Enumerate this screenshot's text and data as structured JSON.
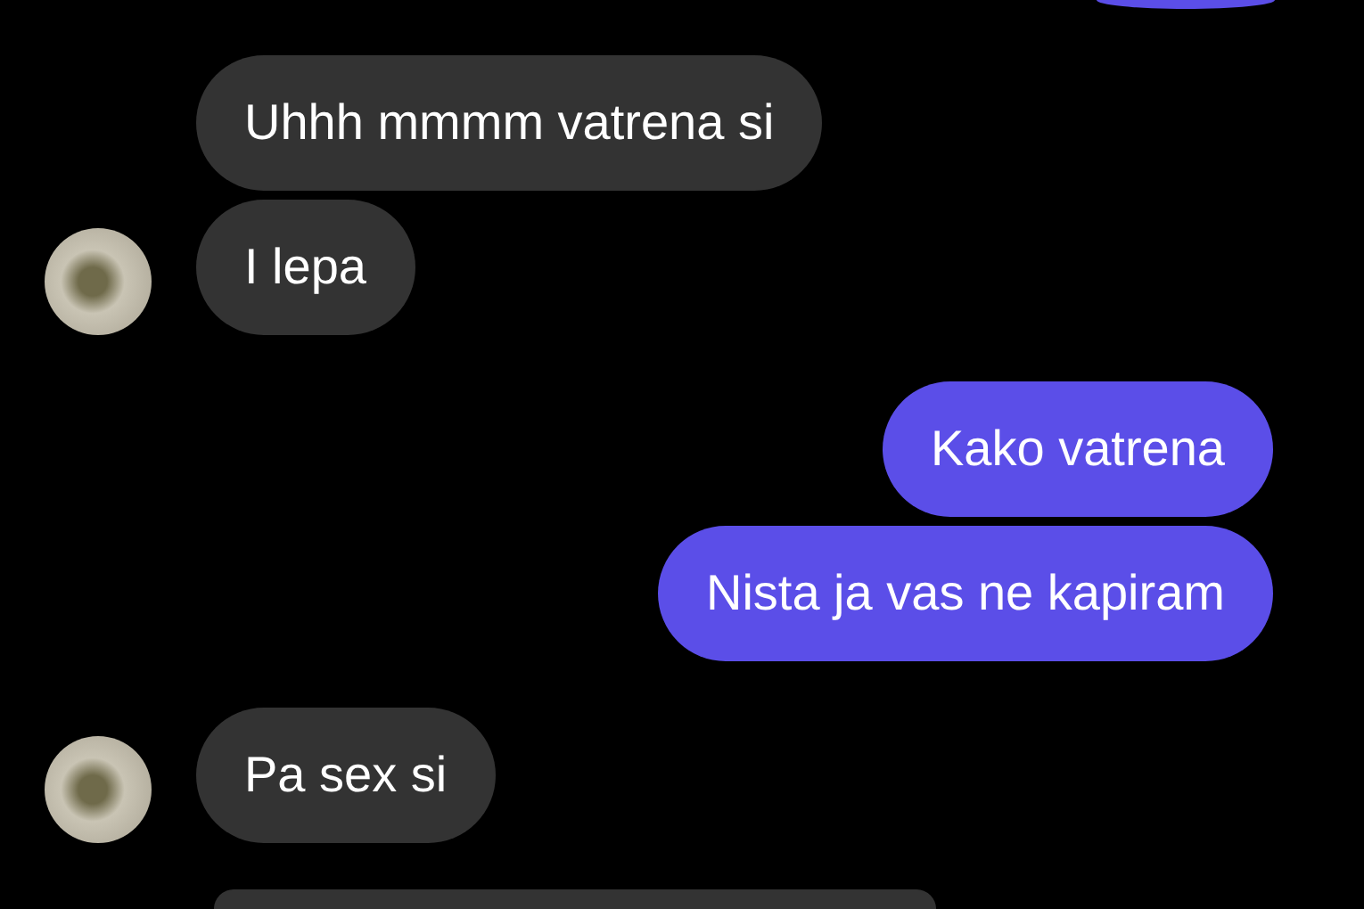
{
  "groups": [
    {
      "outgoing": false,
      "messages": [
        "Uhhh mmmm vatrena si",
        "I lepa"
      ]
    },
    {
      "outgoing": true,
      "messages": [
        "Kako vatrena",
        "Nista ja vas ne kapiram"
      ]
    },
    {
      "outgoing": false,
      "messages": [
        "Pa sex si"
      ]
    }
  ]
}
